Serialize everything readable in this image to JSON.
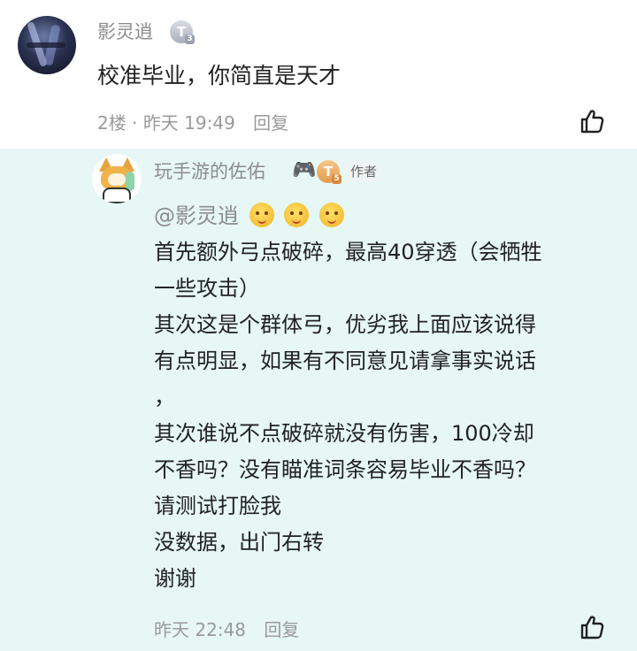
{
  "comment": {
    "user_name": "影灵逍",
    "badge_letter": "T",
    "badge_sub": "3",
    "text": "校准毕业，你简直是天才",
    "floor": "2楼",
    "separator": "·",
    "time": "昨天 19:49",
    "reply_label": "回复"
  },
  "reply": {
    "user_name": "玩手游的佐佑",
    "badge_letter": "T",
    "badge_sub": "5",
    "author_tag": "作者",
    "mention": "@影灵逍",
    "lines": [
      "首先额外弓点破碎，最高40穿透（会牺牲",
      "一些攻击）",
      "其次这是个群体弓，优劣我上面应该说得",
      "有点明显，如果有不同意见请拿事实说话",
      "，",
      "其次谁说不点破碎就没有伤害，100冷却",
      "不香吗？没有瞄准词条容易毕业不香吗？",
      "请测试打脸我",
      "没数据，出门右转",
      "谢谢"
    ],
    "time": "昨天 22:48",
    "reply_label": "回复"
  },
  "icons": {
    "like": "thumbs-up-icon",
    "emoji": "smiling-face-emoji-icon"
  },
  "colors": {
    "reply_background": "#e6f7f5",
    "meta_text": "#9a9a9a"
  }
}
